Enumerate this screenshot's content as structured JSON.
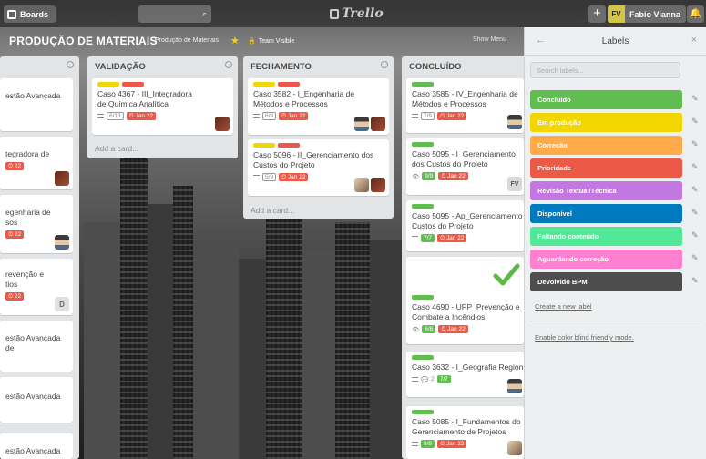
{
  "topbar": {
    "boards_label": "Boards",
    "logo_text": "Trello",
    "add_symbol": "+",
    "member_initials": "FV",
    "member_name": "Fabio Vianna"
  },
  "board": {
    "title": "PRODUÇÃO DE MATERIAIS",
    "org_label": "Produção de Materiais",
    "team_label": "Team Visible",
    "menu_label": "Show Menu"
  },
  "lists": {
    "first": {
      "cards": [
        "estão Avançada",
        "tegradora de",
        "egenharia de\nsos",
        "revenção e\ntios",
        "estão Avançada de",
        "estão Avançada",
        "estão Avançada"
      ],
      "due_fragment": "22",
      "avatar_d": "D"
    },
    "validacao": {
      "title": "VALIDAÇÃO",
      "cards": [
        {
          "title": "Caso 4367 - III_Integradora de Química Analítica",
          "checklist": "6/13",
          "due": "Jan 22"
        }
      ],
      "add_card": "Add a card..."
    },
    "fechamento": {
      "title": "FECHAMENTO",
      "cards": [
        {
          "title": "Caso 3582 - I_Engenharia de Métodos e Processos",
          "checklist": "6/9",
          "due": "Jan 22"
        },
        {
          "title": "Caso 5096 - II_Gerenciamento dos Custos do Projeto",
          "checklist": "5/9",
          "due": "Jan 22"
        }
      ],
      "add_card": "Add a card..."
    },
    "concluido": {
      "title": "CONCLUÍDO",
      "cards": [
        {
          "title": "Caso 3585 - IV_Engenharia de Métodos e Processos",
          "checklist": "7/9",
          "due": "Jan 22"
        },
        {
          "title": "Caso 5095 - I_Gerenciamento dos Custos do Projeto",
          "checklist": "9/9",
          "due": "Jan 22",
          "avatar": "FV"
        },
        {
          "title": "Caso 5095 - Ap_Gerenciamento Custos do Projeto",
          "checklist": "7/7",
          "due": "Jan 22"
        },
        {
          "title": "Caso 4690 - UPP_Prevenção e Combate a Incêndios",
          "checklist": "6/6",
          "due": "Jan 22"
        },
        {
          "title": "Caso 3632 - I_Geografia Regional",
          "comments": "2",
          "checklist": "7/7"
        },
        {
          "title": "Caso 5085 - I_Fundamentos do Gerenciamento de Projetos",
          "checklist": "9/9",
          "due": "Jan 22"
        }
      ]
    }
  },
  "panel": {
    "title": "Labels",
    "back_icon": "←",
    "close_icon": "×",
    "search_placeholder": "Search labels...",
    "labels": [
      {
        "name": "Concluído",
        "color": "#61bd4f"
      },
      {
        "name": "Em produção",
        "color": "#f2d600"
      },
      {
        "name": "Correção",
        "color": "#ffab4a"
      },
      {
        "name": "Prioridade",
        "color": "#eb5a46"
      },
      {
        "name": "Revisão Textual/Técnica",
        "color": "#c377e0"
      },
      {
        "name": "Disponível",
        "color": "#0079bf"
      },
      {
        "name": "Faltando conteúdo",
        "color": "#51e898"
      },
      {
        "name": "Aguardando correção",
        "color": "#ff80ce"
      },
      {
        "name": "Devolvido BPM",
        "color": "#4d4d4d"
      }
    ],
    "create_link": "Create a new label",
    "colorblind_link": "Enable color blind friendly mode."
  },
  "colors": {
    "label_yellow": "#f2d600",
    "label_red": "#eb5a46",
    "label_green": "#61bd4f",
    "due_red": "#eb5a46",
    "list_bg": "#e2e4e6"
  }
}
